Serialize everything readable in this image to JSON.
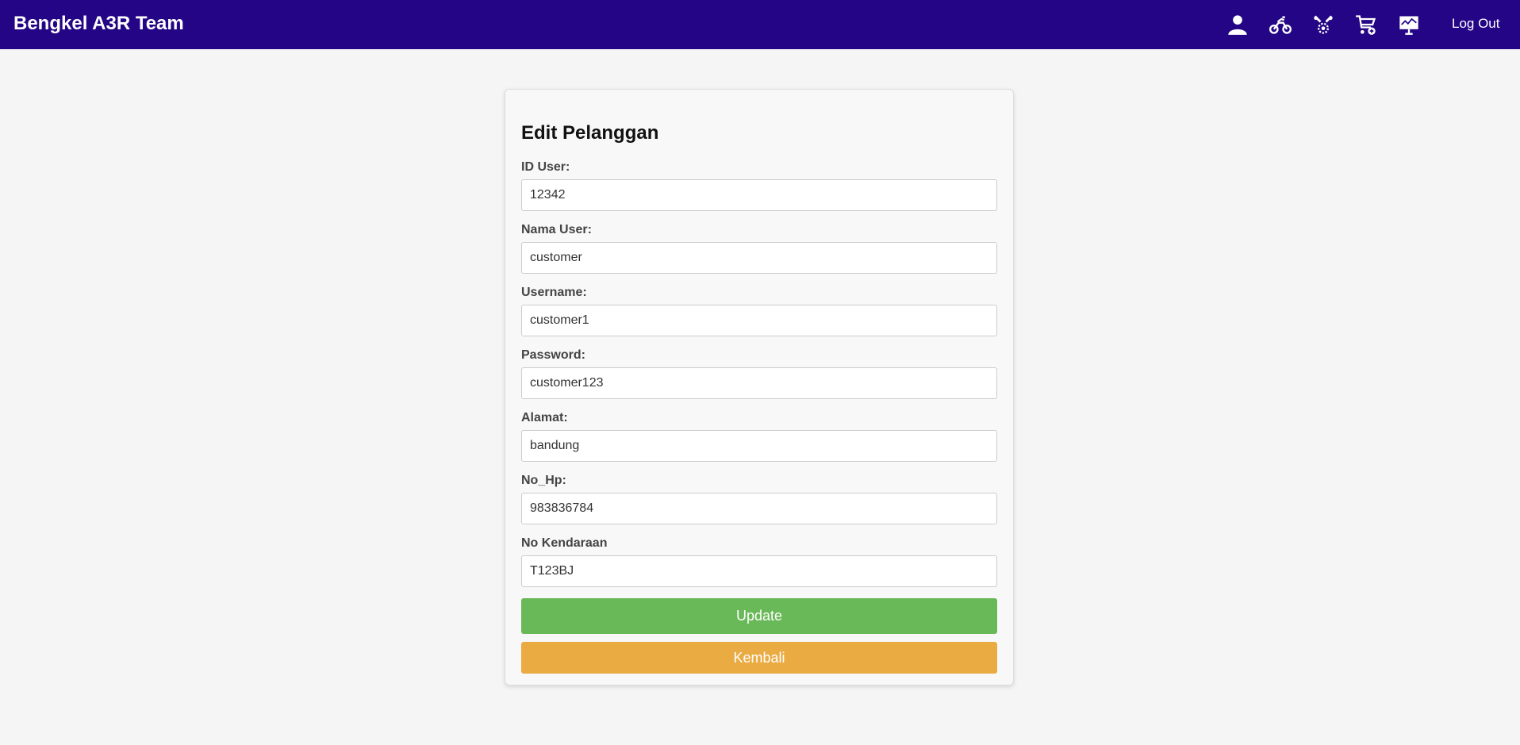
{
  "navbar": {
    "brand": "Bengkel A3R Team",
    "icons": [
      "user-icon",
      "motorcycle-icon",
      "parts-icon",
      "cart-icon",
      "report-icon"
    ],
    "logout_label": "Log Out",
    "background": "#230585"
  },
  "form": {
    "title": "Edit Pelanggan",
    "fields": [
      {
        "label": "ID User:",
        "value": "12342"
      },
      {
        "label": "Nama User:",
        "value": "customer"
      },
      {
        "label": "Username:",
        "value": "customer1"
      },
      {
        "label": "Password:",
        "value": "customer123"
      },
      {
        "label": "Alamat:",
        "value": "bandung"
      },
      {
        "label": "No_Hp:",
        "value": "983836784"
      },
      {
        "label": "No Kendaraan",
        "value": "T123BJ"
      }
    ],
    "update_label": "Update",
    "back_label": "Kembali",
    "update_color": "#6ab958",
    "back_color": "#eaab43"
  }
}
